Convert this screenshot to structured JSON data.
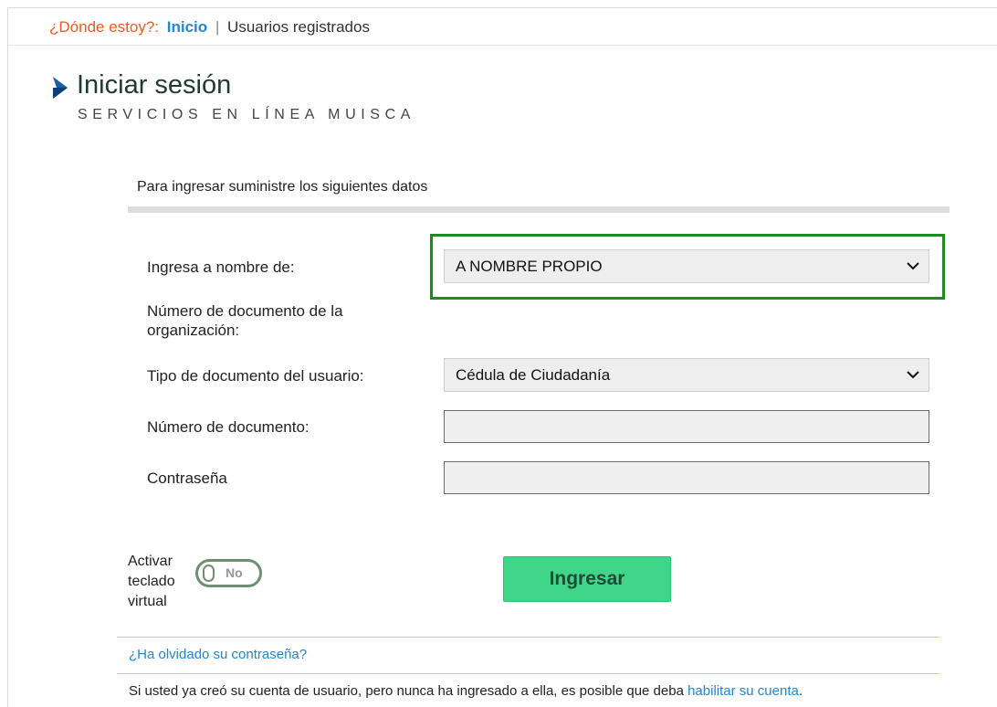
{
  "breadcrumb": {
    "where_label": "¿Dónde estoy?:",
    "home": "Inicio",
    "separator": "|",
    "current": "Usuarios registrados"
  },
  "header": {
    "title": "Iniciar sesión",
    "subtitle": "SERVICIOS EN LÍNEA MUISCA",
    "arrow_icon": "play-arrow-icon",
    "arrow_color": "#1a5fa6"
  },
  "form": {
    "intro": "Para ingresar suministre los siguientes datos",
    "on_behalf": {
      "label": "Ingresa a nombre de:",
      "value": "A NOMBRE PROPIO"
    },
    "org_document": {
      "label": "Número de documento de la organización:"
    },
    "doc_type": {
      "label": "Tipo de documento del usuario:",
      "value": "Cédula de Ciudadanía"
    },
    "doc_number": {
      "label": "Número de documento:",
      "value": ""
    },
    "password": {
      "label": "Contraseña",
      "value": ""
    }
  },
  "virtual_keyboard": {
    "label": "Activar teclado virtual",
    "toggle_text": "No"
  },
  "submit": {
    "label": "Ingresar",
    "color": "#3fd68a"
  },
  "links": {
    "forgot_password": "¿Ha olvidado su contraseña?",
    "activation_note": "Si usted ya creó su cuenta de usuario, pero nunca ha ingresado a ella, es posible que deba",
    "activation_link": "habilitar su cuenta",
    "activation_end": "."
  },
  "colors": {
    "highlight_border": "#1f8a1f",
    "link": "#1e88d6",
    "where_label": "#f05a22"
  }
}
